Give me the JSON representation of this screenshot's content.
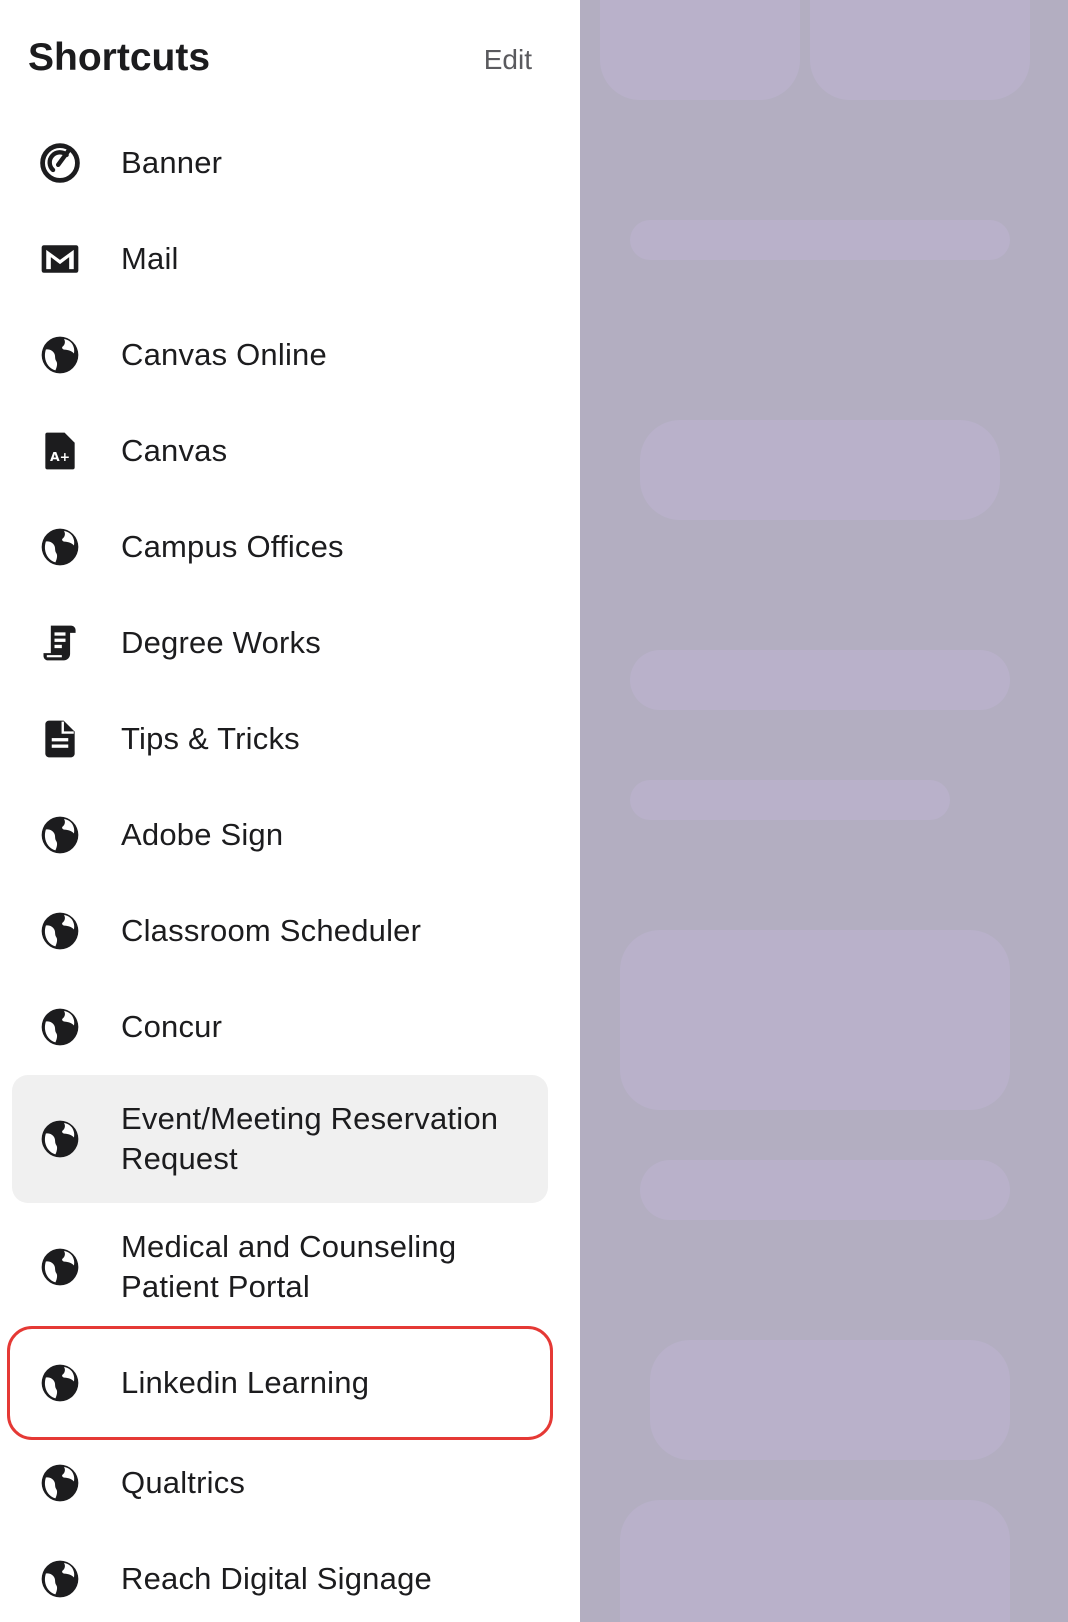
{
  "header": {
    "title": "Shortcuts",
    "edit_label": "Edit"
  },
  "shortcuts": [
    {
      "label": "Banner",
      "icon": "banner-icon"
    },
    {
      "label": "Mail",
      "icon": "mail-icon"
    },
    {
      "label": "Canvas Online",
      "icon": "globe-icon"
    },
    {
      "label": "Canvas",
      "icon": "grade-document-icon"
    },
    {
      "label": "Campus Offices",
      "icon": "globe-icon"
    },
    {
      "label": "Degree Works",
      "icon": "scroll-icon"
    },
    {
      "label": "Tips & Tricks",
      "icon": "document-icon"
    },
    {
      "label": "Adobe Sign",
      "icon": "globe-icon"
    },
    {
      "label": "Classroom Scheduler",
      "icon": "globe-icon"
    },
    {
      "label": "Concur",
      "icon": "globe-icon"
    },
    {
      "label": "Event/Meeting Reservation Request",
      "icon": "globe-icon"
    },
    {
      "label": "Medical and Counseling Patient Portal",
      "icon": "globe-icon"
    },
    {
      "label": "Linkedin Learning",
      "icon": "globe-icon"
    },
    {
      "label": "Qualtrics",
      "icon": "globe-icon"
    },
    {
      "label": "Reach Digital Signage",
      "icon": "globe-icon"
    }
  ],
  "colors": {
    "highlight": "#e53935",
    "pressed_bg": "#f0f0f0",
    "scrim": "#b3aec1"
  }
}
